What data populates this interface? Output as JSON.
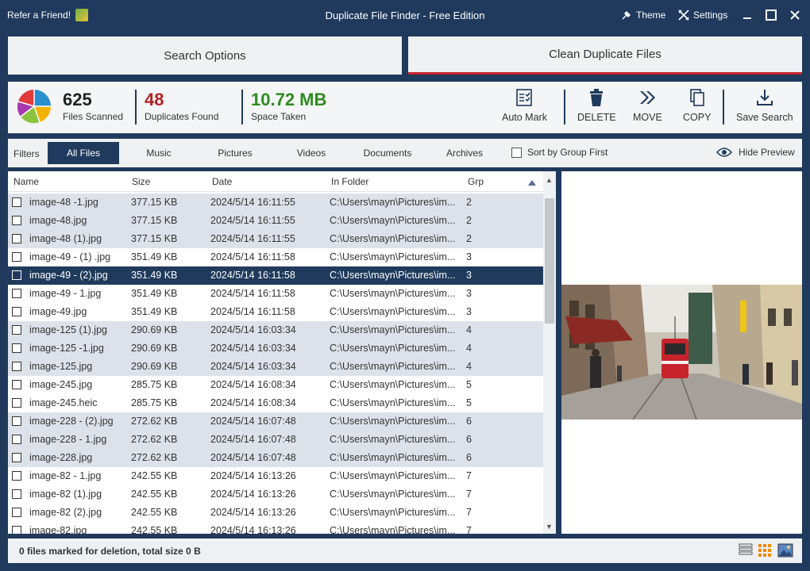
{
  "titlebar": {
    "refer": "Refer a Friend!",
    "title": "Duplicate File Finder - Free Edition",
    "theme": "Theme",
    "settings": "Settings"
  },
  "tabs": {
    "search": "Search Options",
    "clean": "Clean Duplicate Files"
  },
  "stats": {
    "files_scanned_value": "625",
    "files_scanned_label": "Files Scanned",
    "duplicates_value": "48",
    "duplicates_label": "Duplicates Found",
    "space_value": "10.72 MB",
    "space_label": "Space Taken"
  },
  "toolbar": {
    "auto_mark": "Auto Mark",
    "delete": "DELETE",
    "move": "MOVE",
    "copy": "COPY",
    "save_search": "Save Search"
  },
  "filters": {
    "label": "Filters",
    "items": [
      "All Files",
      "Music",
      "Pictures",
      "Videos",
      "Documents",
      "Archives"
    ],
    "active": "All Files",
    "sort_by_group": "Sort by Group First",
    "hide_preview": "Hide Preview"
  },
  "columns": {
    "name": "Name",
    "size": "Size",
    "date": "Date",
    "folder": "In Folder",
    "grp": "Grp"
  },
  "rows": [
    {
      "name": "image-48 -1.jpg",
      "size": "377.15 KB",
      "date": "2024/5/14 16:11:55",
      "folder": "C:\\Users\\mayn\\Pictures\\im...",
      "grp": "2",
      "shade": 1
    },
    {
      "name": "image-48.jpg",
      "size": "377.15 KB",
      "date": "2024/5/14 16:11:55",
      "folder": "C:\\Users\\mayn\\Pictures\\im...",
      "grp": "2",
      "shade": 1
    },
    {
      "name": "image-48 (1).jpg",
      "size": "377.15 KB",
      "date": "2024/5/14 16:11:55",
      "folder": "C:\\Users\\mayn\\Pictures\\im...",
      "grp": "2",
      "shade": 1
    },
    {
      "name": "image-49 - (1)  .jpg",
      "size": "351.49 KB",
      "date": "2024/5/14 16:11:58",
      "folder": "C:\\Users\\mayn\\Pictures\\im...",
      "grp": "3",
      "shade": 0
    },
    {
      "name": "image-49 - (2).jpg",
      "size": "351.49 KB",
      "date": "2024/5/14 16:11:58",
      "folder": "C:\\Users\\mayn\\Pictures\\im...",
      "grp": "3",
      "shade": 0,
      "selected": true
    },
    {
      "name": "image-49 - 1.jpg",
      "size": "351.49 KB",
      "date": "2024/5/14 16:11:58",
      "folder": "C:\\Users\\mayn\\Pictures\\im...",
      "grp": "3",
      "shade": 0
    },
    {
      "name": "image-49.jpg",
      "size": "351.49 KB",
      "date": "2024/5/14 16:11:58",
      "folder": "C:\\Users\\mayn\\Pictures\\im...",
      "grp": "3",
      "shade": 0
    },
    {
      "name": "image-125 (1).jpg",
      "size": "290.69 KB",
      "date": "2024/5/14 16:03:34",
      "folder": "C:\\Users\\mayn\\Pictures\\im...",
      "grp": "4",
      "shade": 1
    },
    {
      "name": "image-125 -1.jpg",
      "size": "290.69 KB",
      "date": "2024/5/14 16:03:34",
      "folder": "C:\\Users\\mayn\\Pictures\\im...",
      "grp": "4",
      "shade": 1
    },
    {
      "name": "image-125.jpg",
      "size": "290.69 KB",
      "date": "2024/5/14 16:03:34",
      "folder": "C:\\Users\\mayn\\Pictures\\im...",
      "grp": "4",
      "shade": 1
    },
    {
      "name": "image-245.jpg",
      "size": "285.75 KB",
      "date": "2024/5/14 16:08:34",
      "folder": "C:\\Users\\mayn\\Pictures\\im...",
      "grp": "5",
      "shade": 0
    },
    {
      "name": "image-245.heic",
      "size": "285.75 KB",
      "date": "2024/5/14 16:08:34",
      "folder": "C:\\Users\\mayn\\Pictures\\im...",
      "grp": "5",
      "shade": 0
    },
    {
      "name": "image-228 - (2).jpg",
      "size": "272.62 KB",
      "date": "2024/5/14 16:07:48",
      "folder": "C:\\Users\\mayn\\Pictures\\im...",
      "grp": "6",
      "shade": 1
    },
    {
      "name": "image-228 - 1.jpg",
      "size": "272.62 KB",
      "date": "2024/5/14 16:07:48",
      "folder": "C:\\Users\\mayn\\Pictures\\im...",
      "grp": "6",
      "shade": 1
    },
    {
      "name": "image-228.jpg",
      "size": "272.62 KB",
      "date": "2024/5/14 16:07:48",
      "folder": "C:\\Users\\mayn\\Pictures\\im...",
      "grp": "6",
      "shade": 1
    },
    {
      "name": "image-82 - 1.jpg",
      "size": "242.55 KB",
      "date": "2024/5/14 16:13:26",
      "folder": "C:\\Users\\mayn\\Pictures\\im...",
      "grp": "7",
      "shade": 0
    },
    {
      "name": "image-82 (1).jpg",
      "size": "242.55 KB",
      "date": "2024/5/14 16:13:26",
      "folder": "C:\\Users\\mayn\\Pictures\\im...",
      "grp": "7",
      "shade": 0
    },
    {
      "name": "image-82 (2).jpg",
      "size": "242.55 KB",
      "date": "2024/5/14 16:13:26",
      "folder": "C:\\Users\\mayn\\Pictures\\im...",
      "grp": "7",
      "shade": 0
    },
    {
      "name": "image-82.jpg",
      "size": "242.55 KB",
      "date": "2024/5/14 16:13:26",
      "folder": "C:\\Users\\mayn\\Pictures\\im...",
      "grp": "7",
      "shade": 0
    }
  ],
  "preview": {
    "image": "street-tram-photo"
  },
  "status": {
    "text": "0 files marked for deletion, total size 0 B"
  },
  "colors": {
    "brand": "#1f3a5c",
    "duplicates": "#b22222",
    "space": "#2e8b1e",
    "accent_red": "#c8232c"
  }
}
